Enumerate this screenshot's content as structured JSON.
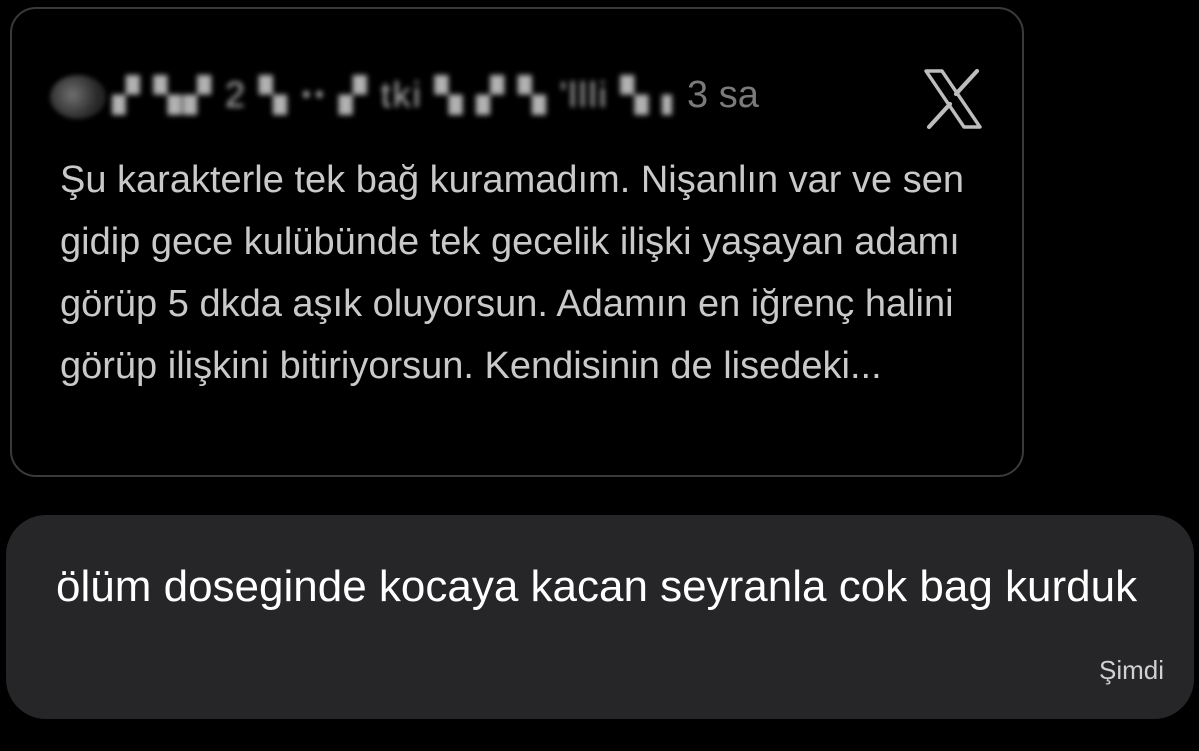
{
  "shared_post": {
    "author_name": "▞ ▚▞ 2 ▚ ꞏꞏ ▞ tki ▚ ▞ ▚ 'llli ▚ ▞",
    "time": "3 sa",
    "platform_icon": "x-logo-icon",
    "text": "Şu karakterle tek bağ kuramadım. Nişanlın var ve sen gidip gece kulübünde tek gecelik ilişki yaşayan adamı görüp 5 dkda aşık oluyorsun. Adamın en iğrenç halini görüp ilişkini bitiriyorsun. Kendisinin de lisedeki..."
  },
  "message": {
    "text": "ölüm doseginde kocaya kacan seyranla cok bag kurduk",
    "time": "Şimdi"
  },
  "colors": {
    "background": "#000000",
    "card_border": "#3a3a3a",
    "bubble": "#262628",
    "tweet_text": "#c9c9c9",
    "message_text": "#ffffff"
  }
}
